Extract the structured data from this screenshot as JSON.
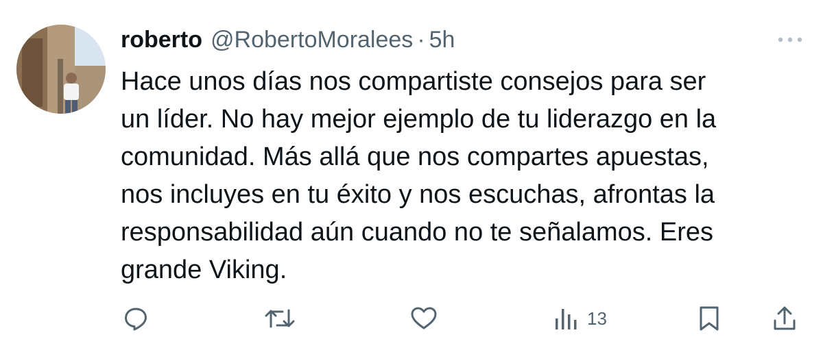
{
  "tweet": {
    "author": {
      "display_name": "roberto",
      "handle": "@RobertoMoralees",
      "separator": "·",
      "time": "5h",
      "avatar_icon": "profile-photo"
    },
    "text": "Hace unos días nos compartiste consejos para ser\nun líder. No hay mejor ejemplo de tu liderazgo en la\ncomunidad. Más allá que nos compartes apuestas,\nnos incluyes en tu éxito y nos escuchas, afrontas la\nresponsabilidad aún cuando no te señalamos. Eres\ngrande Viking.",
    "more_icon": "more-icon",
    "actions": {
      "reply_icon": "reply-icon",
      "retweet_icon": "retweet-icon",
      "like_icon": "like-icon",
      "views_icon": "views-icon",
      "views_count": "13",
      "bookmark_icon": "bookmark-icon",
      "share_icon": "share-icon"
    }
  },
  "colors": {
    "text": "#0f1419",
    "secondary": "#536471",
    "icon": "#536471",
    "background": "#ffffff"
  }
}
